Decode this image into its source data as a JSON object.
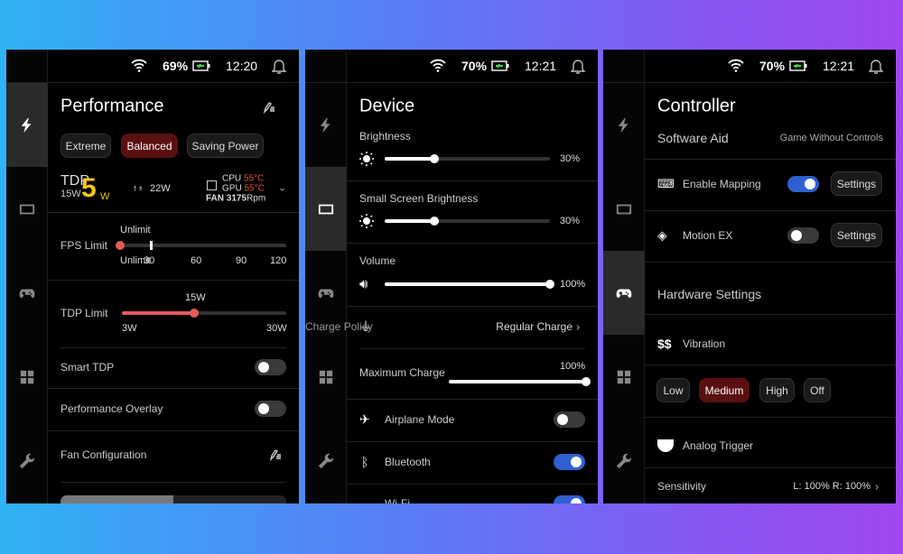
{
  "colors": {
    "accent_red": "#e85a5a",
    "selected_bg": "#5a1010",
    "toggle_on": "#2f5fd0",
    "temp": "#e05040",
    "tdp_yellow": "#f5c518"
  },
  "sidebar_icons": [
    "lightning-icon",
    "screen-icon",
    "gamepad-icon",
    "grid-icon",
    "wrench-icon"
  ],
  "panels": [
    {
      "status": {
        "battery": "69%",
        "time": "12:20"
      },
      "active_tab": 0,
      "title": "Performance",
      "modes": [
        "Extreme",
        "Balanced",
        "Saving Power"
      ],
      "selected_mode": "Balanced",
      "tdp": {
        "label": "TDP",
        "base": "15W",
        "value": "5",
        "unit": "W",
        "power": "22W",
        "cpu_label": "CPU",
        "cpu_temp": "55°C",
        "gpu_label": "GPU",
        "gpu_temp": "55°C",
        "fan_label": "FAN",
        "fan_value": "3175",
        "fan_unit": "Rpm"
      },
      "fps": {
        "label": "FPS Limit",
        "current": "Unlimit",
        "ticks": [
          "Unlimit",
          "30",
          "60",
          "90",
          "120"
        ]
      },
      "tdp_limit": {
        "label": "TDP Limit",
        "current": "15W",
        "min": "3W",
        "max": "30W",
        "percent": 44
      },
      "smart_tdp": {
        "label": "Smart TDP",
        "on": false
      },
      "overlay": {
        "label": "Performance Overlay",
        "on": false
      },
      "fan": {
        "label": "Fan Configuration"
      }
    },
    {
      "status": {
        "battery": "70%",
        "time": "12:21"
      },
      "active_tab": 1,
      "title": "Device",
      "brightness": {
        "label": "Brightness",
        "value": "30%",
        "percent": 30
      },
      "small_brightness": {
        "label": "Small Screen Brightness",
        "value": "30%",
        "percent": 30
      },
      "volume": {
        "label": "Volume",
        "value": "100%",
        "percent": 100
      },
      "charge_policy": {
        "label": "Charge Policy",
        "value": "Regular Charge"
      },
      "max_charge": {
        "label": "Maximum Charge",
        "value": "100%",
        "percent": 100
      },
      "airplane": {
        "label": "Airplane Mode",
        "on": false
      },
      "bluetooth": {
        "label": "Bluetooth",
        "on": true
      },
      "wifi": {
        "label": "Wi-Fi",
        "on": true
      }
    },
    {
      "status": {
        "battery": "70%",
        "time": "12:21"
      },
      "active_tab": 2,
      "title": "Controller",
      "software_aid": {
        "label": "Software Aid",
        "value": "Game Without Controls"
      },
      "mapping": {
        "label": "Enable Mapping",
        "on": true,
        "button": "Settings"
      },
      "motion": {
        "label": "Motion EX",
        "on": false,
        "button": "Settings"
      },
      "hardware": "Hardware Settings",
      "vibration": {
        "label": "Vibration",
        "options": [
          "Low",
          "Medium",
          "High",
          "Off"
        ],
        "selected": "Medium"
      },
      "analog": {
        "label": "Analog Trigger"
      },
      "sensitivity": {
        "label": "Sensitivity",
        "value": "L: 100% R: 100%"
      }
    }
  ]
}
